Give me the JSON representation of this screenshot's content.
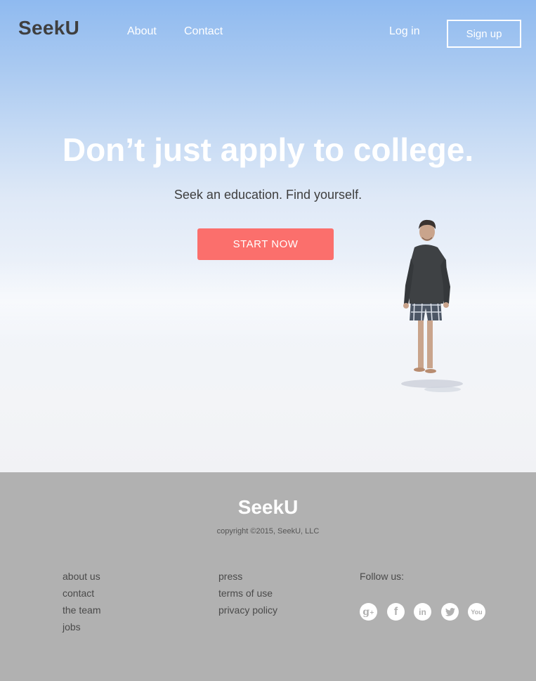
{
  "header": {
    "logo": "SeekU",
    "nav": {
      "about": "About",
      "contact": "Contact"
    },
    "login": "Log in",
    "signup": "Sign up"
  },
  "hero": {
    "headline": "Don’t just apply to college.",
    "subhead": "Seek an education. Find yourself.",
    "cta": "START NOW"
  },
  "footer": {
    "logo": "SeekU",
    "copyright": "copyright ©2015, SeekU, LLC",
    "links_col1": [
      "about us",
      "contact",
      "the team",
      "jobs"
    ],
    "links_col2": [
      "press",
      "terms of use",
      "privacy policy"
    ],
    "follow_label": "Follow us:",
    "social_icons": [
      "google-plus-icon",
      "facebook-icon",
      "linkedin-icon",
      "twitter-icon",
      "youtube-icon"
    ]
  },
  "colors": {
    "accent": "#fb6f6c",
    "footer_bg": "#b1b1b1",
    "logo_dark": "#3f3f3f"
  }
}
